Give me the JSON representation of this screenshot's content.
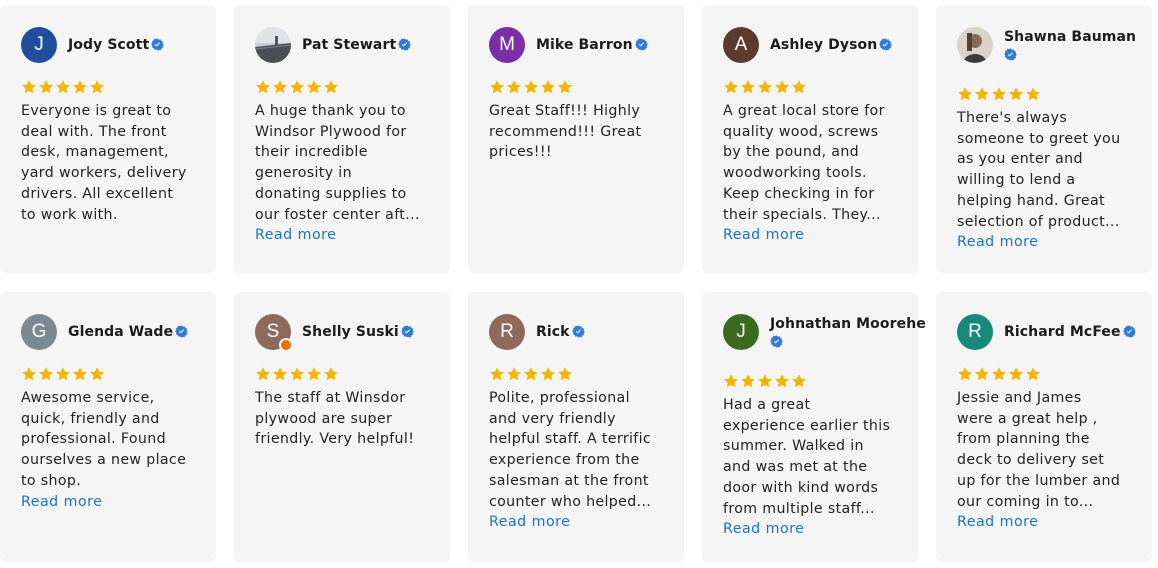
{
  "reviews": [
    {
      "name": "Jody Scott",
      "initial": "J",
      "avatar_color": "#1f4f9c",
      "rating": 5,
      "lines": [
        "Everyone is great to",
        "deal with. The front",
        "desk, management,",
        "yard workers, delivery",
        "drivers. All excellent",
        "to work with."
      ],
      "read_more": ""
    },
    {
      "name": "Pat Stewart",
      "initial": "",
      "avatar_color": "#6b7380",
      "rating": 5,
      "lines": [
        "A huge thank you to",
        "Windsor Plywood for",
        "their incredible",
        "generosity in",
        "donating supplies to",
        "our foster center aft..."
      ],
      "read_more": "Read more"
    },
    {
      "name": "Mike Barron",
      "initial": "M",
      "avatar_color": "#7b2ea8",
      "rating": 5,
      "lines": [
        "Great Staff!!! Highly",
        "recommend!!! Great",
        "prices!!!"
      ],
      "read_more": ""
    },
    {
      "name": "Ashley Dyson",
      "initial": "A",
      "avatar_color": "#5d3a2e",
      "rating": 5,
      "lines": [
        "A great local store for",
        "quality wood, screws",
        "by the pound, and",
        "woodworking tools.",
        "Keep checking in for",
        "their specials. They..."
      ],
      "read_more": "Read more"
    },
    {
      "name": "Shawna Bauman",
      "initial": "",
      "avatar_color": "#b8a89a",
      "rating": 5,
      "lines": [
        "There's always",
        "someone to greet you",
        "as you enter and",
        "willing to lend a",
        "helping hand. Great",
        "selection of product..."
      ],
      "read_more": "Read more"
    },
    {
      "name": "Glenda Wade",
      "initial": "G",
      "avatar_color": "#7a8a93",
      "rating": 5,
      "lines": [
        "Awesome service,",
        "quick, friendly and",
        "professional. Found",
        "ourselves a new place",
        "to shop."
      ],
      "read_more": "Read more"
    },
    {
      "name": "Shelly Suski",
      "initial": "S",
      "avatar_color": "#8d6a5c",
      "rating": 5,
      "lines": [
        "The staff at Winsdor",
        "plywood are super",
        "friendly. Very helpful!"
      ],
      "read_more": ""
    },
    {
      "name": "Rick",
      "initial": "R",
      "avatar_color": "#8d6a5c",
      "rating": 5,
      "lines": [
        "Polite, professional",
        "and very friendly",
        "helpful staff. A terrific",
        "experience from the",
        "salesman at the front",
        "counter who helped..."
      ],
      "read_more": "Read more"
    },
    {
      "name": "Johnathan Moorehe",
      "initial": "J",
      "avatar_color": "#3b6a1f",
      "rating": 5,
      "lines": [
        "Had a great",
        "experience earlier this",
        "summer. Walked in",
        "and was met at the",
        "door with kind words",
        "from multiple staff..."
      ],
      "read_more": "Read more"
    },
    {
      "name": "Richard McFee",
      "initial": "R",
      "avatar_color": "#16897a",
      "rating": 5,
      "lines": [
        "Jessie and James",
        "were a great help ,",
        "from planning the",
        "deck to delivery set",
        "up for the lumber and",
        "our coming in to..."
      ],
      "read_more": "Read more"
    }
  ],
  "colors": {
    "star": "#f5b400",
    "verified": "#2f7bd6",
    "link": "#1a73c9",
    "card_bg": "#f5f5f5"
  }
}
